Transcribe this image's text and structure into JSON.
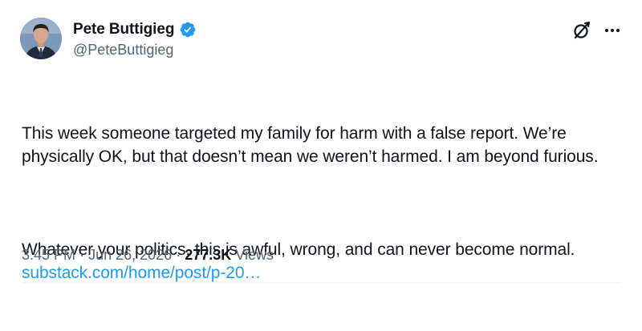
{
  "author": {
    "display_name": "Pete Buttigieg",
    "handle": "@PeteButtigieg",
    "verified": true,
    "verified_color": "#1d9bf0",
    "avatar_icon": "profile-photo"
  },
  "actions": {
    "grok_icon": "grok-icon",
    "more_icon": "more-icon"
  },
  "tweet": {
    "paragraph_1": "This week someone targeted my family for harm with a false report. We’re physically OK, but that doesn’t mean we weren’t harmed. I am beyond furious.",
    "paragraph_2_text": "Whatever your politics, this is awful, wrong, and can never become normal. ",
    "link_text": "substack.com/home/post/p-20…",
    "link_color": "#1d9bf0"
  },
  "meta": {
    "time": "3:45 PM",
    "separator": "·",
    "date": "Jun 26, 2026",
    "views_count": "277.3K",
    "views_label": "Views"
  },
  "colors": {
    "text": "#0f1419",
    "secondary_text": "#536471",
    "divider": "#eff3f4"
  }
}
